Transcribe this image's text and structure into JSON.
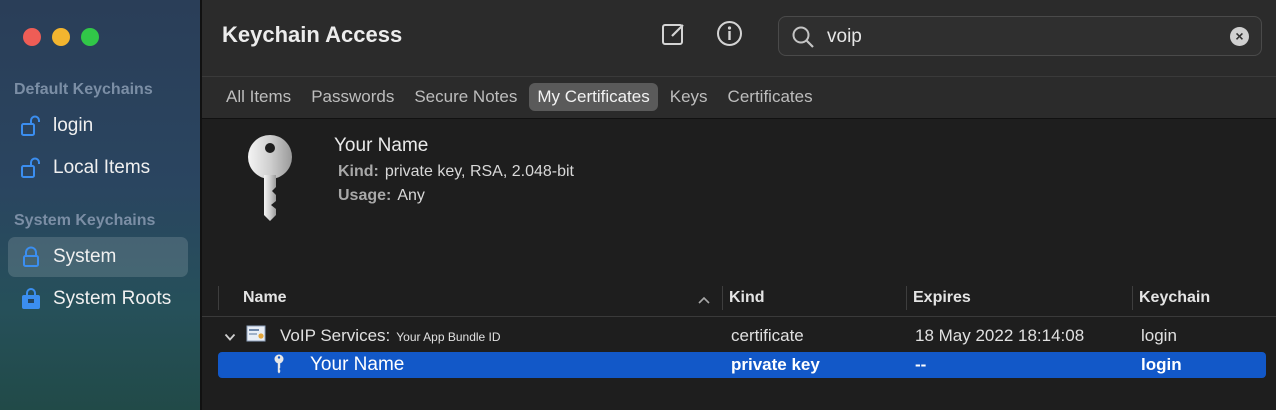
{
  "window": {
    "title": "Keychain Access"
  },
  "sidebar": {
    "sections": [
      {
        "title": "Default Keychains",
        "items": [
          {
            "label": "login",
            "icon": "unlock-icon"
          },
          {
            "label": "Local Items",
            "icon": "unlock-icon"
          }
        ]
      },
      {
        "title": "System Keychains",
        "items": [
          {
            "label": "System",
            "icon": "lock-icon",
            "selected": true
          },
          {
            "label": "System Roots",
            "icon": "lock-icon"
          }
        ]
      }
    ]
  },
  "search": {
    "value": "voip"
  },
  "tabs": [
    "All Items",
    "Passwords",
    "Secure Notes",
    "My Certificates",
    "Keys",
    "Certificates"
  ],
  "active_tab": "My Certificates",
  "detail": {
    "name": "Your Name",
    "kind_label": "Kind:",
    "kind_value": "private key, RSA, 2.048-bit",
    "usage_label": "Usage:",
    "usage_value": "Any"
  },
  "table": {
    "columns": [
      "Name",
      "Kind",
      "Expires",
      "Keychain"
    ],
    "rows": [
      {
        "name": "VoIP Services:",
        "name_suffix": "Your App Bundle ID",
        "kind": "certificate",
        "expires": "18 May 2022 18:14:08",
        "keychain": "login"
      },
      {
        "name": "Your Name",
        "kind": "private key",
        "expires": "--",
        "keychain": "login",
        "selected": true
      }
    ]
  },
  "colors": {
    "accent": "#1258c8",
    "sidebar_icon": "#3b8ef0"
  }
}
